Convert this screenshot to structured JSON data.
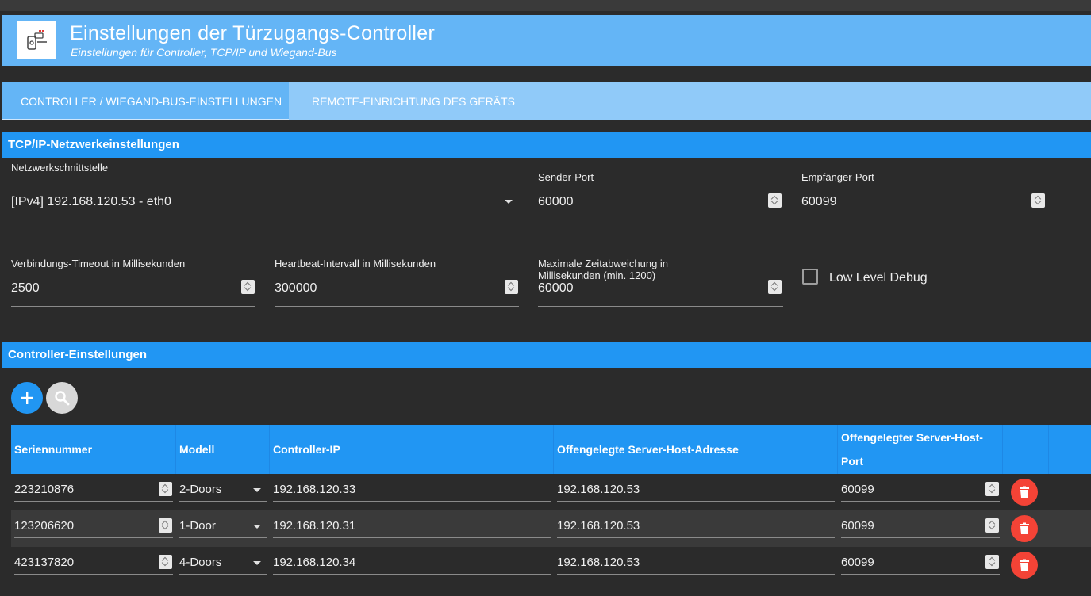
{
  "header": {
    "title": "Einstellungen der Türzugangs-Controller",
    "subtitle": "Einstellungen für Controller, TCP/IP und Wiegand-Bus",
    "logo_icon": "door-access-icon"
  },
  "tabs": [
    {
      "label": "Controller / Wiegand-Bus-Einstellungen",
      "active": true
    },
    {
      "label": "Remote-Einrichtung des Geräts",
      "active": false
    }
  ],
  "tcp": {
    "section_title": "TCP/IP-Netzwerkeinstellungen",
    "interface": {
      "label": "Netzwerkschnittstelle",
      "value": "[IPv4] 192.168.120.53 - eth0"
    },
    "sender_port": {
      "label": "Sender-Port",
      "value": "60000"
    },
    "receiver_port": {
      "label": "Empfänger-Port",
      "value": "60099"
    },
    "timeout": {
      "label": "Verbindungs-Timeout in Millisekunden",
      "value": "2500"
    },
    "heartbeat": {
      "label": "Heartbeat-Intervall in Millisekunden",
      "value": "300000"
    },
    "max_dev": {
      "label_line1": "Maximale Zeitabweichung in",
      "label_line2": "Millisekunden (min. 1200)",
      "value": "60000"
    },
    "debug": {
      "label": "Low Level Debug",
      "checked": false
    }
  },
  "controllers": {
    "section_title": "Controller-Einstellungen",
    "add_icon": "plus-icon",
    "search_icon": "search-icon",
    "columns": [
      "Seriennummer",
      "Modell",
      "Controller-IP",
      "Offengelegte Server-Host-Adresse",
      "Offengelegter Server-Host-",
      "Port"
    ],
    "rows": [
      {
        "serial": "223210876",
        "model": "2-Doors",
        "ip": "192.168.120.33",
        "host": "192.168.120.53",
        "port": "60099"
      },
      {
        "serial": "123206620",
        "model": "1-Door",
        "ip": "192.168.120.31",
        "host": "192.168.120.53",
        "port": "60099"
      },
      {
        "serial": "423137820",
        "model": "4-Doors",
        "ip": "192.168.120.34",
        "host": "192.168.120.53",
        "port": "60099"
      }
    ],
    "delete_icon": "trash-icon",
    "colors": {
      "header": "#2196f3",
      "delete": "#f44336"
    }
  }
}
